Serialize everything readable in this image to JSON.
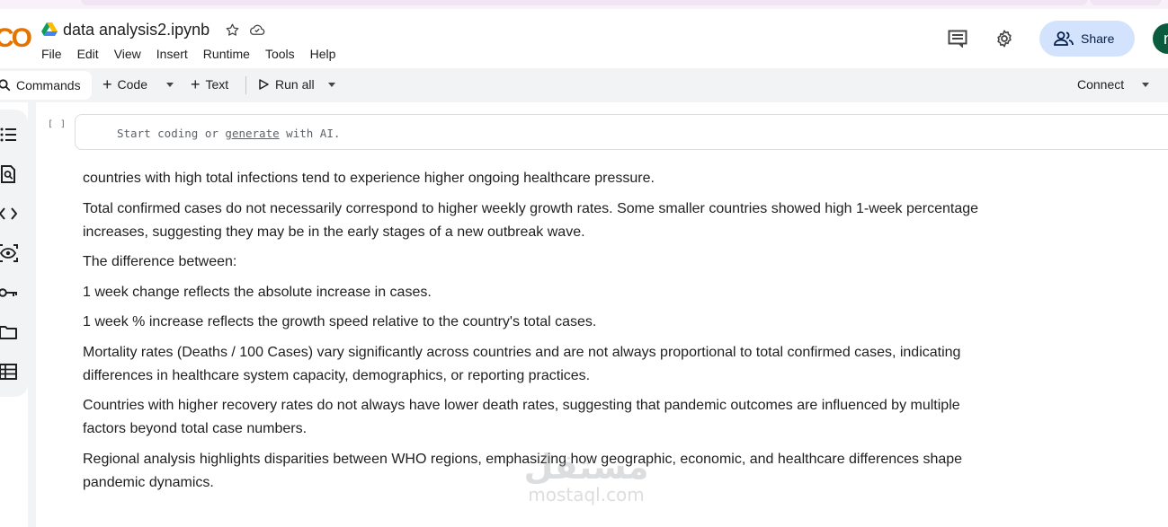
{
  "app": {
    "logo_text": "CO",
    "notebook_title": "data analysis2.ipynb"
  },
  "menu": [
    "File",
    "Edit",
    "View",
    "Insert",
    "Runtime",
    "Tools",
    "Help"
  ],
  "header": {
    "share_label": "Share",
    "avatar_letter": "n"
  },
  "toolbar": {
    "commands_label": "Commands",
    "code_label": "Code",
    "text_label": "Text",
    "run_all_label": "Run all",
    "connect_label": "Connect"
  },
  "code_cell": {
    "bracket": "[ ]",
    "placeholder_before": "Start coding or ",
    "placeholder_link": "generate",
    "placeholder_after": " with AI."
  },
  "text_cell": {
    "paragraphs": [
      "countries with high total infections tend to experience higher ongoing healthcare pressure.",
      "Total confirmed cases do not necessarily correspond to higher weekly growth rates. Some smaller countries showed high 1-week percentage increases, suggesting they may be in the early stages of a new outbreak wave.",
      "The difference between:",
      "1 week change reflects the absolute increase in cases.",
      "1 week % increase reflects the growth speed relative to the country's total cases.",
      "Mortality rates (Deaths / 100 Cases) vary significantly across countries and are not always proportional to total confirmed cases, indicating differences in healthcare system capacity, demographics, or reporting practices.",
      "Countries with higher recovery rates do not always have lower death rates, suggesting that pandemic outcomes are influenced by multiple factors beyond total case numbers.",
      "Regional analysis highlights disparities between WHO regions, emphasizing how geographic, economic, and healthcare differences shape pandemic dynamics."
    ]
  },
  "watermark": {
    "arabic": "مستقل",
    "latin": "mostaql.com"
  },
  "colors": {
    "share_bg": "#d3e3fd",
    "toolbar_bg": "#f2f3f5",
    "logo_orange": "#f9ab00",
    "avatar_bg": "#0b5b3f"
  }
}
